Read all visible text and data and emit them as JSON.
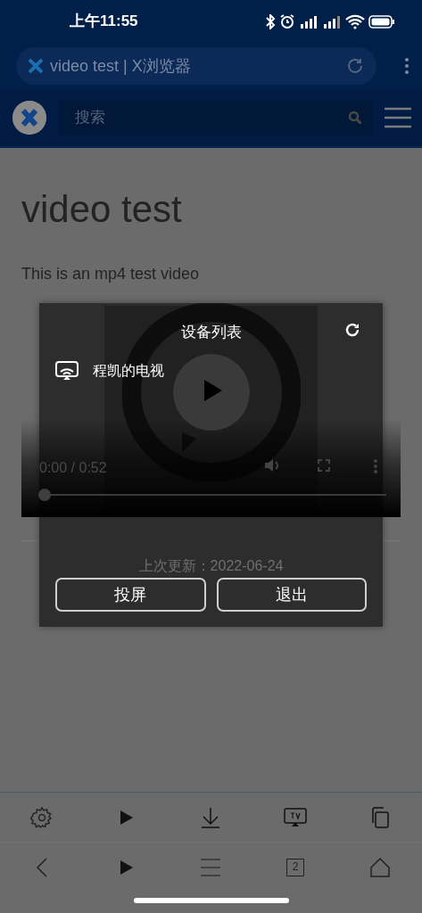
{
  "status_bar": {
    "time": "上午11:55"
  },
  "address_bar": {
    "title": "video test | X浏览器"
  },
  "site_header": {
    "search": {
      "placeholder": "搜索"
    }
  },
  "page": {
    "heading": "video test",
    "paragraph": "This is an mp4 test video",
    "video": {
      "time": "0:00 / 0:52",
      "level": 0
    },
    "footer": "上次更新：2022-06-24"
  },
  "dialog": {
    "title": "设备列表",
    "devices": [
      {
        "name": "程凯的电视"
      }
    ],
    "buttons": [
      "投屏",
      "退出"
    ]
  },
  "toolbar": {
    "tab_count": "2"
  }
}
